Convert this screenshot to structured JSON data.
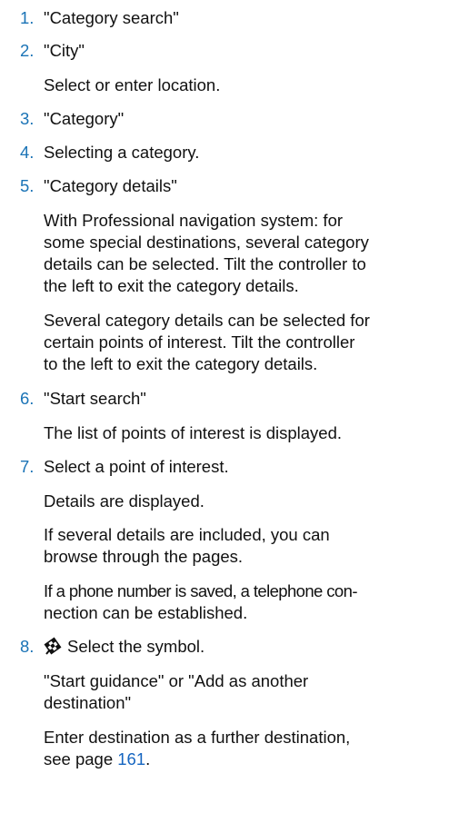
{
  "steps": [
    {
      "number": "1.",
      "title": "\"Category search\""
    },
    {
      "number": "2.",
      "title": "\"City\"",
      "detail": "Select or enter location."
    },
    {
      "number": "3.",
      "title": "\"Category\""
    },
    {
      "number": "4.",
      "title": "Selecting a category."
    },
    {
      "number": "5.",
      "title": "\"Category details\"",
      "para1": [
        "With Professional navigation system: for",
        "some special destinations, several category",
        "details can be selected. Tilt the controller to",
        "the left to exit the category details."
      ],
      "para2": [
        "Several category details can be selected for",
        "certain points of interest. Tilt the controller",
        "to the left to exit the category details."
      ]
    },
    {
      "number": "6.",
      "title": "\"Start search\"",
      "detail": "The list of points of interest is displayed."
    },
    {
      "number": "7.",
      "title": "Select a point of interest.",
      "detail": "Details are displayed.",
      "para1": [
        "If several details are included, you can",
        "browse through the pages."
      ],
      "para2": [
        "If a phone number is saved, a telephone con-",
        "nection can be established."
      ]
    },
    {
      "number": "8.",
      "title": "Select the symbol.",
      "icon": "destination-flag-icon",
      "para1": [
        "\"Start guidance\" or \"Add as another",
        "destination\""
      ],
      "para2_line1": "Enter destination as a further destination,",
      "para2_prefix": "see page ",
      "page_link": "161",
      "para2_suffix": "."
    }
  ],
  "colors": {
    "step_number": "#1a73b6",
    "link": "#1565c0",
    "text": "#111111"
  }
}
